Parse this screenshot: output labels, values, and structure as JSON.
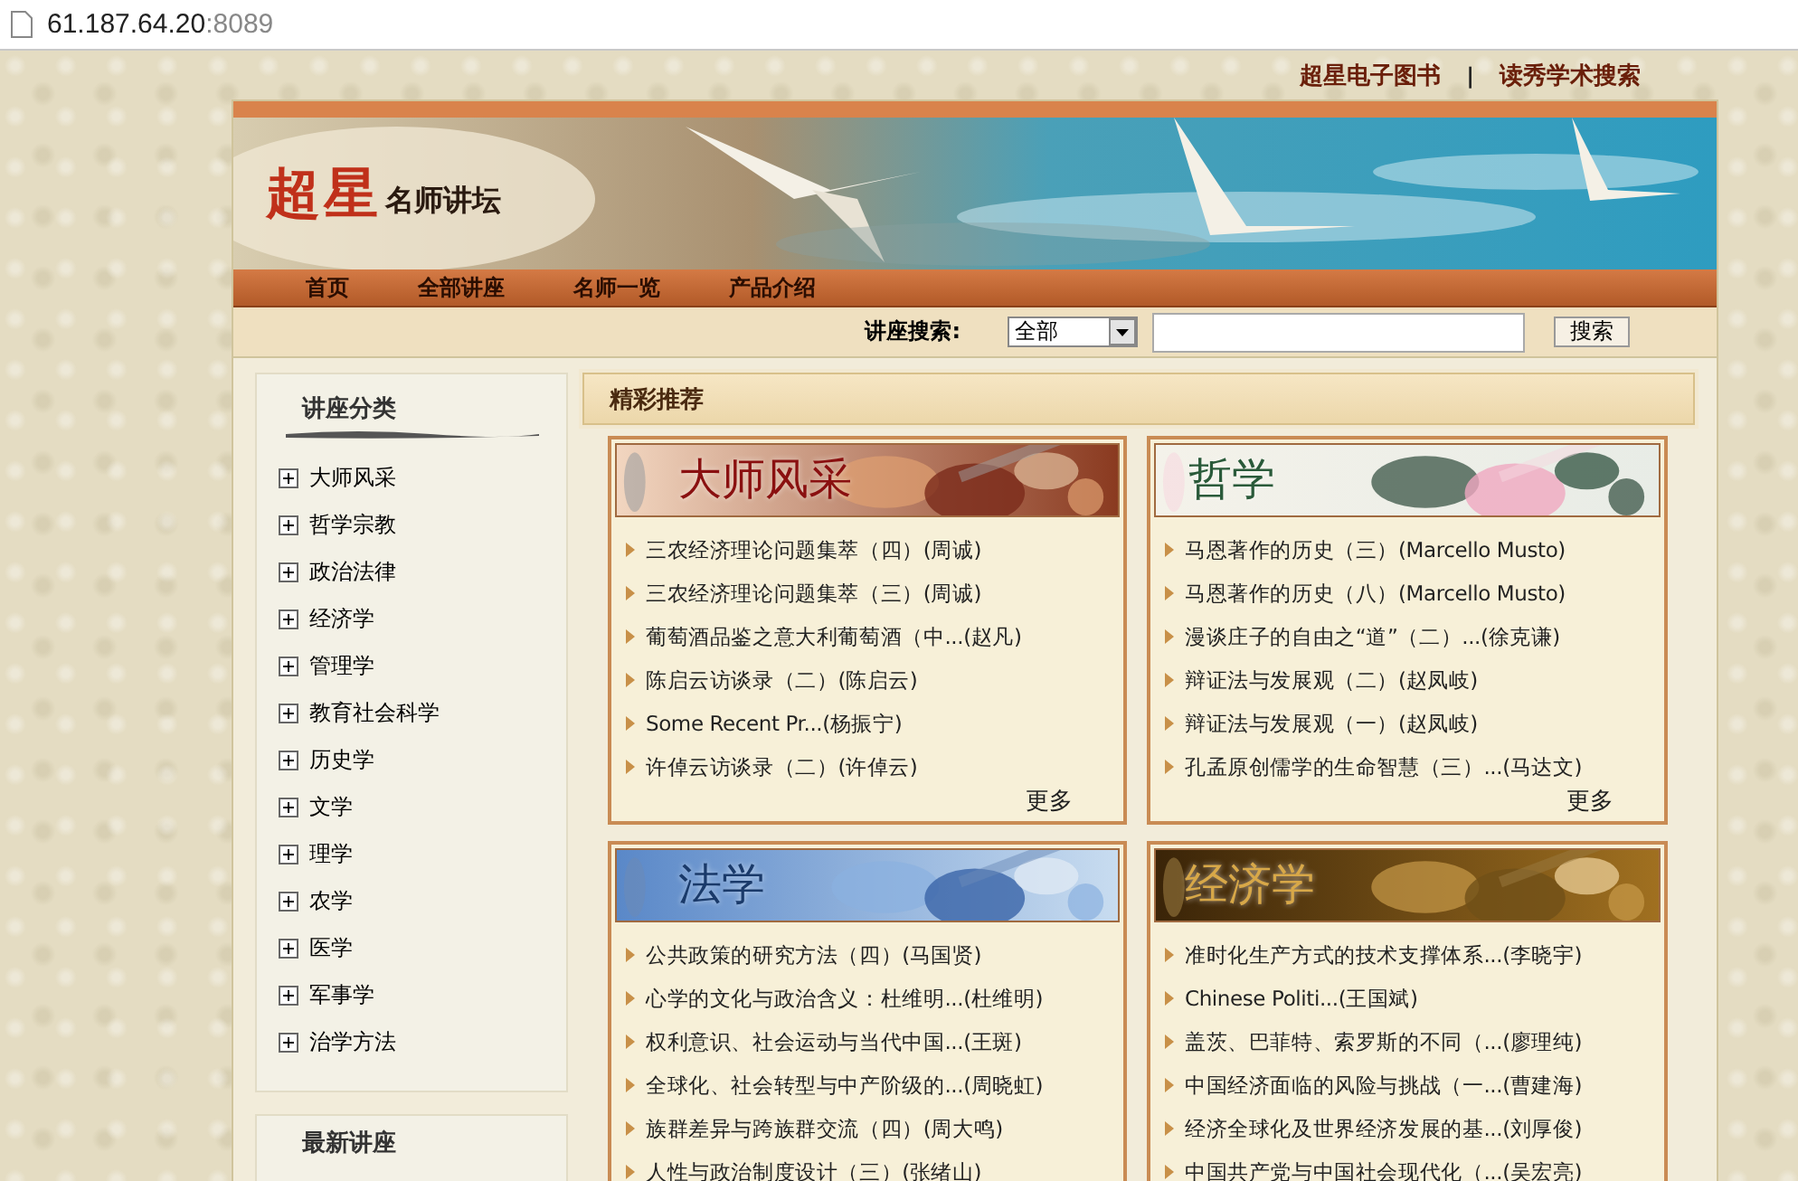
{
  "address_bar": {
    "host": "61.187.64.20",
    "port": ":8089"
  },
  "top_links": {
    "items": [
      "超星电子图书",
      "读秀学术搜索"
    ],
    "separator": "|"
  },
  "logo": {
    "mark": "超星",
    "title": "名师讲坛"
  },
  "nav": [
    "首页",
    "全部讲座",
    "名师一览",
    "产品介绍"
  ],
  "search": {
    "label": "讲座搜索:",
    "scope": "全部",
    "button": "搜索"
  },
  "sidebar": {
    "title": "讲座分类",
    "categories": [
      {
        "label": "大师风采",
        "expanded": false
      },
      {
        "label": "哲学宗教",
        "expanded": false
      },
      {
        "label": "政治法律",
        "expanded": false
      },
      {
        "label": "经济学",
        "expanded": false
      },
      {
        "label": "管理学",
        "expanded": false
      },
      {
        "label": "教育社会科学",
        "expanded": false
      },
      {
        "label": "历史学",
        "expanded": false
      },
      {
        "label": "文学",
        "expanded": false
      },
      {
        "label": "理学",
        "expanded": false
      },
      {
        "label": "农学",
        "expanded": false
      },
      {
        "label": "医学",
        "expanded": false
      },
      {
        "label": "军事学",
        "expanded": false
      },
      {
        "label": "治学方法",
        "expanded": false
      }
    ],
    "latest_title": "最新讲座"
  },
  "featured": {
    "title": "精彩推荐",
    "sections": [
      {
        "title": "大师风采",
        "kind": "master",
        "more": "更多",
        "items": [
          "三农经济理论问题集萃（四）(周诚)",
          "三农经济理论问题集萃（三）(周诚)",
          "葡萄酒品鉴之意大利葡萄酒（中...(赵凡)",
          "陈启云访谈录（二）(陈启云)",
          "Some Recent Pr...(杨振宁)",
          "许倬云访谈录（二）(许倬云)"
        ]
      },
      {
        "title": "哲学",
        "kind": "philosophy",
        "more": "更多",
        "items": [
          "马恩著作的历史（三）(Marcello Musto)",
          "马恩著作的历史（八）(Marcello Musto)",
          "漫谈庄子的自由之“道”（二）...(徐克谦)",
          "辩证法与发展观（二）(赵凤岐)",
          "辩证法与发展观（一）(赵凤岐)",
          "孔孟原创儒学的生命智慧（三）...(马达文)"
        ]
      },
      {
        "title": "法学",
        "kind": "law",
        "items": [
          "公共政策的研究方法（四）(马国贤)",
          "心学的文化与政治含义：杜维明...(杜维明)",
          "权利意识、社会运动与当代中国...(王斑)",
          "全球化、社会转型与中产阶级的...(周晓虹)",
          "族群差异与跨族群交流（四）(周大鸣)",
          "人性与政治制度设计（三）(张绪山)"
        ]
      },
      {
        "title": "经济学",
        "kind": "economics",
        "items": [
          "准时化生产方式的技术支撑体系...(李晓宇)",
          "Chinese Politi...(王国斌)",
          "盖茨、巴菲特、索罗斯的不同（...(廖理纯)",
          "中国经济面临的风险与挑战（一...(曹建海)",
          "经济全球化及世界经济发展的基...(刘厚俊)",
          "中国共产党与中国社会现代化（...(吴宏亮)"
        ]
      }
    ]
  }
}
